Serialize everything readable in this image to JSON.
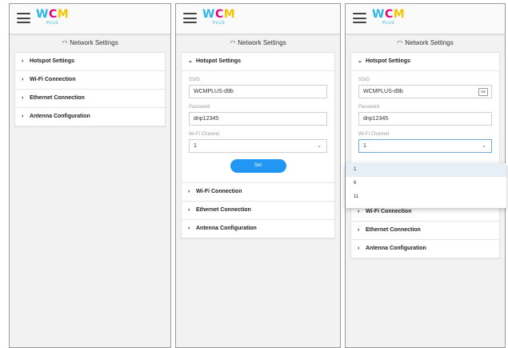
{
  "logo": {
    "main": "WCM",
    "sub": "PLUS"
  },
  "page_title": "Network Settings",
  "sections": {
    "hotspot": "Hotspot Settings",
    "wifi": "Wi-Fi Connection",
    "ethernet": "Ethernet Connection",
    "antenna": "Antenna Configuration"
  },
  "hotspot_form": {
    "ssid_label": "SSID",
    "ssid_value": "WCMPLUS-d9b",
    "password_label": "Password",
    "password_value": "dnp12345",
    "channel_label": "Wi-Fi Channel",
    "channel_value": "1",
    "set_button": "Set"
  },
  "channel_options": [
    "1",
    "6",
    "11"
  ],
  "icons": {
    "menu": "hamburger-menu-icon",
    "wifi": "wifi-icon",
    "expand": "chevron-right-icon",
    "collapse": "chevron-down-icon",
    "key": "keyboard-icon"
  },
  "colors": {
    "accent": "#2196f3",
    "logo_w": "#2ab6e8",
    "logo_c": "#e6007e",
    "logo_m": "#f5c400"
  }
}
